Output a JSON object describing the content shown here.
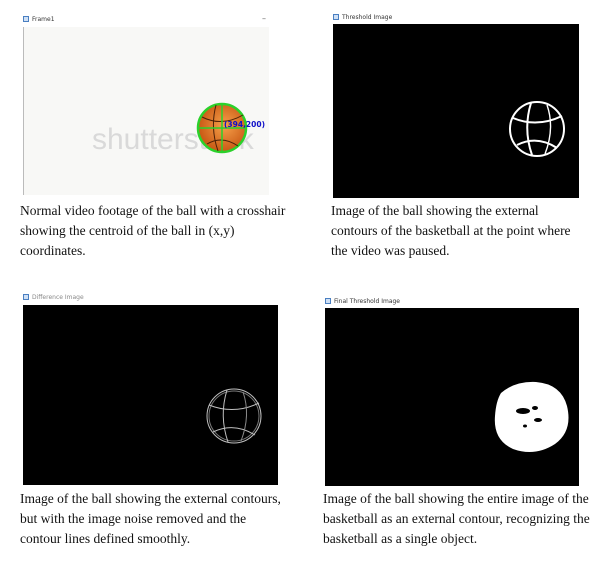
{
  "panels": [
    {
      "window_title": "Frame1",
      "overlay_text": "(394,200)",
      "watermark": "shutterstock",
      "caption": "Normal video footage of the ball with a crosshair showing the centroid of the ball in (x,y) coordinates."
    },
    {
      "window_title": "Threshold Image",
      "caption": "Image of the ball showing the external contours of the basketball at the point where the video was paused."
    },
    {
      "window_title": "Difference Image",
      "caption": "Image of the ball showing the external contours, but with the image noise removed and the contour lines defined smoothly."
    },
    {
      "window_title": "Final Threshold Image",
      "caption": "Image of the ball showing the entire image of the basketball as an external contour, recognizing the basketball as a single object."
    }
  ],
  "colors": {
    "frame_bg": "#f8f8f6",
    "ball_orange": "#e8731a",
    "crosshair_green": "#2bd12b",
    "overlay_text": "#1010c8",
    "video_black": "#000000"
  }
}
